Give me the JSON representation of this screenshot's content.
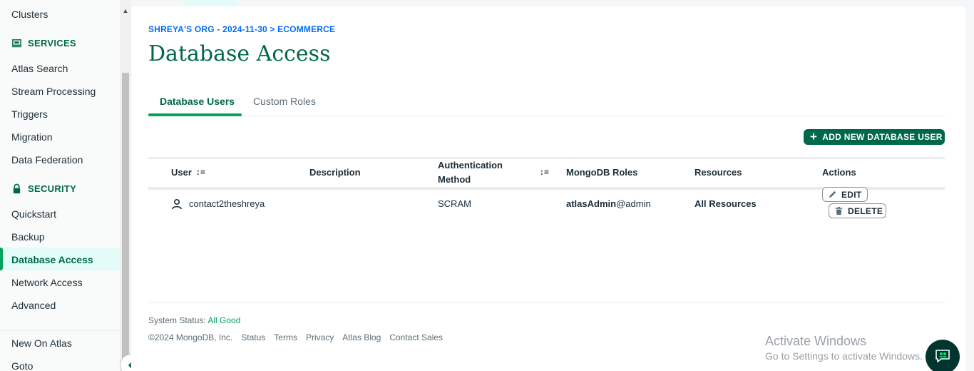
{
  "sidebar": {
    "clusters": "Clusters",
    "services_label": "SERVICES",
    "services_items": [
      "Atlas Search",
      "Stream Processing",
      "Triggers",
      "Migration",
      "Data Federation"
    ],
    "security_label": "SECURITY",
    "security_items": [
      "Quickstart",
      "Backup",
      "Database Access",
      "Network Access",
      "Advanced"
    ],
    "active_item": "Database Access",
    "bottom_items": [
      "New On Atlas",
      "Goto"
    ]
  },
  "breadcrumb": "SHREYA'S ORG - 2024-11-30 > ECOMMERCE",
  "title": "Database Access",
  "tabs": [
    "Database Users",
    "Custom Roles"
  ],
  "active_tab": "Database Users",
  "add_button": "ADD NEW DATABASE USER",
  "table": {
    "headers": {
      "user": "User",
      "description": "Description",
      "auth_line1": "Authentication",
      "auth_line2": "Method",
      "roles": "MongoDB Roles",
      "resources": "Resources",
      "actions": "Actions"
    },
    "rows": [
      {
        "user": "contact2theshreya",
        "description": "",
        "auth": "SCRAM",
        "role_name": "atlasAdmin",
        "role_db": "@admin",
        "resources": "All Resources",
        "edit": "EDIT",
        "delete": "DELETE"
      }
    ]
  },
  "footer": {
    "status_label": "System Status:",
    "status_value": "All Good",
    "copyright": "©2024 MongoDB, Inc.",
    "links": [
      "Status",
      "Terms",
      "Privacy",
      "Atlas Blog",
      "Contact Sales"
    ]
  },
  "windows": {
    "line1": "Activate Windows",
    "line2": "Go to Settings to activate Windows."
  },
  "colors": {
    "accent_green": "#00684a",
    "bright_green": "#00a35c",
    "link_blue": "#016bf8"
  }
}
